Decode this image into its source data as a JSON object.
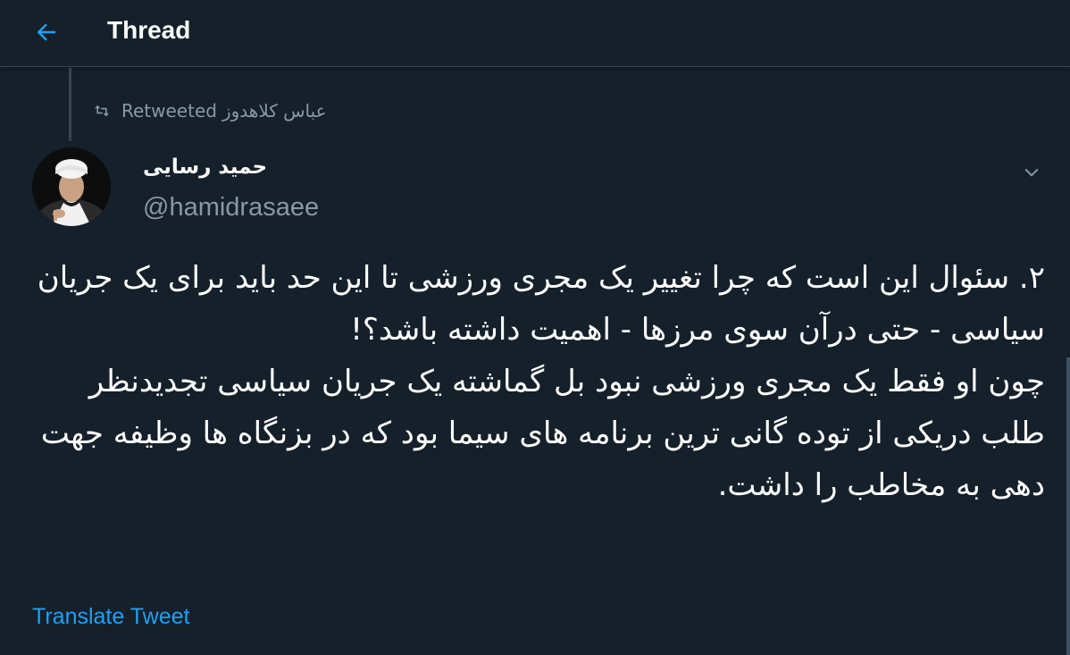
{
  "header": {
    "title": "Thread",
    "back_icon": "arrow-left-icon"
  },
  "social_context": {
    "icon": "retweet-icon",
    "label": "Retweeted",
    "retweeter": "عباس کلاهدوز"
  },
  "tweet": {
    "display_name": "حمید رسایی",
    "username": "@hamidrasaee",
    "paragraph_1": "۲. سئوال این است که چرا تغییر یک مجری ورزشی تا این حد باید برای یک جریان سیاسی - حتی درآن سوی مرزها - اهمیت داشته باشد؟!",
    "paragraph_2": "چون او فقط یک مجری ورزشی نبود بل گماشته یک جریان سیاسی تجدیدنظر طلب دریکی از توده گانی ترین برنامه های سیما بود که در بزنگاه ها وظیفه جهت دهی به مخاطب را داشت.",
    "translate_label": "Translate Tweet"
  },
  "colors": {
    "background": "#15202b",
    "accent": "#1da1f2",
    "secondary_text": "#8899a6",
    "divider": "#38444d"
  }
}
